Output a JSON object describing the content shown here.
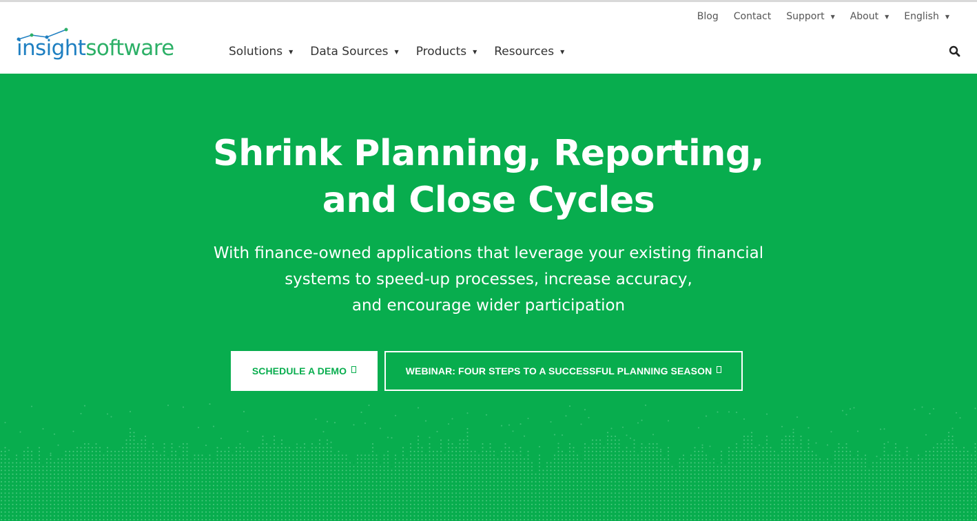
{
  "brand": {
    "logo_part1": "insight",
    "logo_part2": "software",
    "colors": {
      "blue": "#1e7fc1",
      "green": "#2db067"
    }
  },
  "utility_nav": {
    "items": [
      {
        "label": "Blog",
        "dropdown": false
      },
      {
        "label": "Contact",
        "dropdown": false
      },
      {
        "label": "Support",
        "dropdown": true
      },
      {
        "label": "About",
        "dropdown": true
      },
      {
        "label": "English",
        "dropdown": true
      }
    ]
  },
  "main_nav": {
    "items": [
      {
        "label": "Solutions"
      },
      {
        "label": "Data Sources"
      },
      {
        "label": "Products"
      },
      {
        "label": "Resources"
      }
    ]
  },
  "icons": {
    "search": "search-icon",
    "external": "external-link-icon",
    "caret": "caret-down-icon"
  },
  "hero": {
    "background_color": "#08ad4e",
    "title_line1": "Shrink Planning, Reporting,",
    "title_line2": "and Close Cycles",
    "subtitle_line1": "With finance-owned applications that leverage your existing financial",
    "subtitle_line2": "systems to speed-up processes, increase accuracy,",
    "subtitle_line3": "and encourage wider participation",
    "cta_primary": "SCHEDULE A DEMO",
    "cta_secondary": "WEBINAR: FOUR STEPS TO A SUCCESSFUL PLANNING SEASON"
  }
}
